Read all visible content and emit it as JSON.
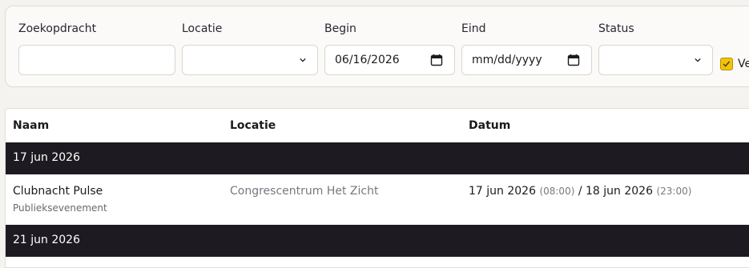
{
  "filters": {
    "search": {
      "label": "Zoekopdracht",
      "value": ""
    },
    "location": {
      "label": "Locatie",
      "selected": ""
    },
    "begin": {
      "label": "Begin",
      "value": "06/16/2026"
    },
    "end": {
      "label": "Eind",
      "placeholder": "mm/dd/yyyy"
    },
    "status": {
      "label": "Status",
      "selected": ""
    },
    "checkbox_label": "Ve"
  },
  "table": {
    "columns": [
      "Naam",
      "Locatie",
      "Datum"
    ],
    "groups": [
      {
        "date": "17 jun 2026",
        "events": [
          {
            "name": "Clubnacht Pulse",
            "type": "Publieksevenement",
            "location": "Congrescentrum Het Zicht",
            "start_date": "17 jun 2026",
            "start_time": "(08:00)",
            "separator": "/",
            "end_date": "18 jun 2026",
            "end_time": "(23:00)"
          }
        ]
      },
      {
        "date": "21 jun 2026",
        "events": []
      }
    ]
  },
  "colors": {
    "accent_checkbox": "#f2c30d",
    "group_header_bg": "#1e1a21"
  }
}
